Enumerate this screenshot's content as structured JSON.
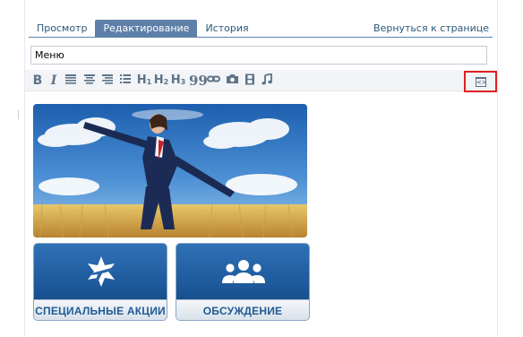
{
  "tabs": [
    {
      "label": "Просмотр",
      "active": false
    },
    {
      "label": "Редактирование",
      "active": true
    },
    {
      "label": "История",
      "active": false
    }
  ],
  "return_link": "Вернуться к странице",
  "title_field": {
    "value": "Меню"
  },
  "toolbar": {
    "bold": "B",
    "italic": "I",
    "h1": "H",
    "h2": "H",
    "h3": "H",
    "h1_sub": "1",
    "h2_sub": "2",
    "h3_sub": "3",
    "quote": "99",
    "icons": [
      "bold-icon",
      "italic-icon",
      "align-left-icon",
      "align-center-icon",
      "align-right-icon",
      "list-icon",
      "heading1-icon",
      "heading2-icon",
      "heading3-icon",
      "quote-icon",
      "link-icon",
      "photo-icon",
      "video-icon",
      "audio-icon",
      "source-code-icon"
    ]
  },
  "content": {
    "banners": [
      {
        "label": "СПЕЦИАЛЬНЫЕ АКЦИИ",
        "icon": "plane-star-icon"
      },
      {
        "label": "ОБСУЖДЕНИЕ",
        "icon": "group-people-icon"
      }
    ]
  },
  "colors": {
    "accent": "#5e80a8",
    "link": "#2b587a",
    "highlight": "#e02020",
    "toolbar_icon": "#5e7388"
  }
}
